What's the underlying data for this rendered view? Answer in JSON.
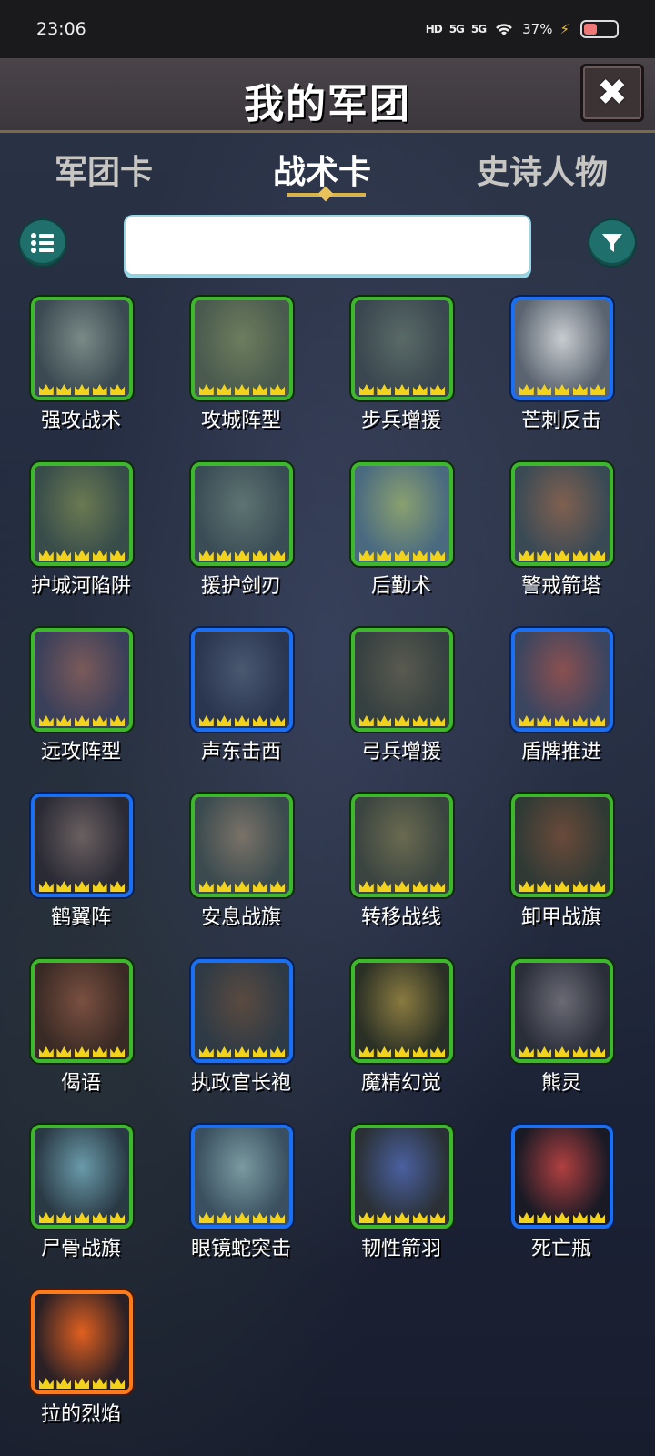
{
  "status": {
    "time": "23:06",
    "hd": "HD",
    "signal1": "5G",
    "signal2": "5G",
    "battery": "37%"
  },
  "header": {
    "title": "我的军团",
    "close_icon": "close-icon"
  },
  "tabs": [
    {
      "label": "军团卡",
      "active": false
    },
    {
      "label": "战术卡",
      "active": true
    },
    {
      "label": "史诗人物",
      "active": false
    }
  ],
  "search": {
    "value": "",
    "placeholder": ""
  },
  "cards": [
    {
      "label": "强攻战术",
      "rarity": "green",
      "art": [
        "#3b4a52",
        "#7a8a86"
      ]
    },
    {
      "label": "攻城阵型",
      "rarity": "green",
      "art": [
        "#4a5a4e",
        "#6d7d5e"
      ]
    },
    {
      "label": "步兵增援",
      "rarity": "green",
      "art": [
        "#3a4750",
        "#5a6a66"
      ]
    },
    {
      "label": "芒刺反击",
      "rarity": "blue",
      "art": [
        "#5a6470",
        "#c8ccd0"
      ]
    },
    {
      "label": "护城河陷阱",
      "rarity": "green",
      "art": [
        "#384c4a",
        "#6a7a52"
      ]
    },
    {
      "label": "援护剑刃",
      "rarity": "green",
      "art": [
        "#3a4d56",
        "#5e7472"
      ]
    },
    {
      "label": "后勤术",
      "rarity": "green",
      "art": [
        "#4a6a80",
        "#8aa070"
      ]
    },
    {
      "label": "警戒箭塔",
      "rarity": "green",
      "art": [
        "#3a4a55",
        "#806050"
      ]
    },
    {
      "label": "远攻阵型",
      "rarity": "green",
      "art": [
        "#3a3f5a",
        "#7a5a5a"
      ]
    },
    {
      "label": "声东击西",
      "rarity": "blue",
      "art": [
        "#2a3550",
        "#4a5870"
      ]
    },
    {
      "label": "弓兵增援",
      "rarity": "green",
      "art": [
        "#354040",
        "#5a5a50"
      ]
    },
    {
      "label": "盾牌推进",
      "rarity": "blue",
      "art": [
        "#3a4560",
        "#8a5050"
      ]
    },
    {
      "label": "鹤翼阵",
      "rarity": "blue",
      "art": [
        "#2a2a35",
        "#6a6060"
      ]
    },
    {
      "label": "安息战旗",
      "rarity": "green",
      "art": [
        "#3a4a4e",
        "#7a7268"
      ]
    },
    {
      "label": "转移战线",
      "rarity": "green",
      "art": [
        "#3a4440",
        "#6a6a50"
      ]
    },
    {
      "label": "卸甲战旗",
      "rarity": "green",
      "art": [
        "#303a35",
        "#6a4a3a"
      ]
    },
    {
      "label": "偈语",
      "rarity": "green",
      "art": [
        "#3a2a25",
        "#7a5040"
      ]
    },
    {
      "label": "执政官长袍",
      "rarity": "blue",
      "art": [
        "#2e3a45",
        "#5a4a40"
      ]
    },
    {
      "label": "魔精幻觉",
      "rarity": "green",
      "art": [
        "#2a3025",
        "#8a7a40"
      ]
    },
    {
      "label": "熊灵",
      "rarity": "green",
      "art": [
        "#2a2e38",
        "#6a6a75"
      ]
    },
    {
      "label": "尸骨战旗",
      "rarity": "green",
      "art": [
        "#2a3a45",
        "#6a9aaa"
      ]
    },
    {
      "label": "眼镜蛇突击",
      "rarity": "blue",
      "art": [
        "#3a5060",
        "#7a9aa0"
      ]
    },
    {
      "label": "韧性箭羽",
      "rarity": "green",
      "art": [
        "#2a3035",
        "#4a60a0"
      ]
    },
    {
      "label": "死亡瓶",
      "rarity": "blue",
      "art": [
        "#1a1a25",
        "#b04040"
      ]
    },
    {
      "label": "拉的烈焰",
      "rarity": "orange",
      "art": [
        "#2a2025",
        "#e06020"
      ]
    }
  ]
}
